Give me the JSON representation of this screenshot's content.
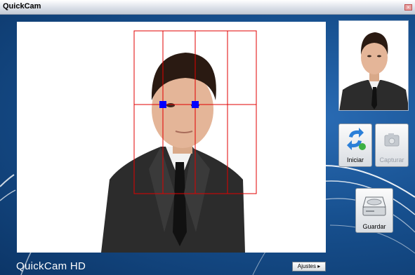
{
  "window": {
    "title": "QuickCam",
    "close_glyph": "×"
  },
  "thumbnail": {
    "alt": "captured photo thumbnail"
  },
  "buttons": {
    "start_label": "Iniciar",
    "capture_label": "Capturar",
    "save_label": "Guardar",
    "settings_label": "Ajustes ▸"
  },
  "brand": {
    "text": "QuickCam HD"
  },
  "icons": {
    "start": "refresh-icon",
    "capture": "camera-icon",
    "save": "drive-icon",
    "close": "close-icon"
  },
  "colors": {
    "guide_lines": "#e00000",
    "markers": "#0000ff",
    "background": "#17508f"
  }
}
